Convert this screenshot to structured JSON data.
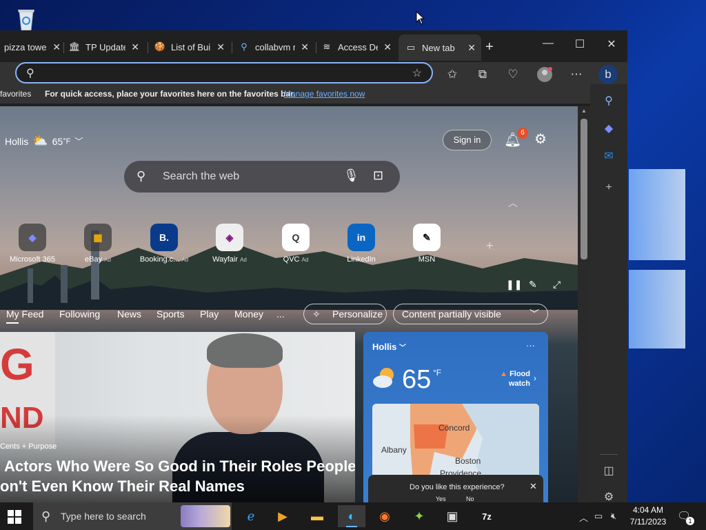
{
  "browser": {
    "tabs": [
      {
        "title": "pizza towe",
        "icon": "edge-page-icon"
      },
      {
        "title": "TP Update",
        "icon": "building-icon"
      },
      {
        "title": "List of Buil",
        "icon": "cookie-icon"
      },
      {
        "title": "collabvm r",
        "icon": "search-icon"
      },
      {
        "title": "Access De",
        "icon": "stack-icon"
      },
      {
        "title": "New tab",
        "icon": "newtab-icon"
      }
    ],
    "new_tab_symbol": "+",
    "address": {
      "value": "",
      "placeholder": ""
    },
    "favorites": {
      "left_label": "favorites",
      "message": "For quick access, place your favorites here on the favorites bar.",
      "link": "Manage favorites now"
    }
  },
  "newtab": {
    "location": "Hollis",
    "temp": "65",
    "unit": "°F",
    "signin": "Sign in",
    "notif_count": "6",
    "search_placeholder": "Search the web",
    "quick_links": [
      {
        "label": "Microsoft 365",
        "ad": "",
        "icon": "m365-icon",
        "glyph": "◆",
        "color": "#6d7ff2"
      },
      {
        "label": "eBay",
        "ad": "Ad",
        "icon": "ebay-icon",
        "glyph": "▦",
        "color": "#e53238"
      },
      {
        "label": "Booking.c...",
        "ad": "Ad",
        "icon": "booking-icon",
        "glyph": "B.",
        "color": "#0a3a8a"
      },
      {
        "label": "Wayfair",
        "ad": "Ad",
        "icon": "wayfair-icon",
        "glyph": "◈",
        "color": "#7f187f"
      },
      {
        "label": "QVC",
        "ad": "Ad",
        "icon": "qvc-icon",
        "glyph": "Q",
        "color": "#e23d3d"
      },
      {
        "label": "LinkedIn",
        "ad": "",
        "icon": "linkedin-icon",
        "glyph": "in",
        "color": "#0a66c2"
      },
      {
        "label": "MSN",
        "ad": "",
        "icon": "msn-icon",
        "glyph": "✎",
        "color": "#111111"
      }
    ],
    "feed_tabs": [
      "My Feed",
      "Following",
      "News",
      "Sports",
      "Play",
      "Money",
      "..."
    ],
    "personalize": "Personalize",
    "content_visibility": "Content partially visible",
    "hero": {
      "sign_text1": "G",
      "sign_text2": "ND",
      "source": "Cents + Purpose",
      "headline_line1": "Actors Who Were So Good in Their Roles People",
      "headline_line2": "on't Even Know Their Real Names"
    },
    "weather": {
      "city": "Hollis",
      "temp": "65",
      "unit": "°F",
      "alert": "Flood watch",
      "map_labels": [
        "Concord",
        "Albany",
        "Boston",
        "Providence"
      ]
    },
    "survey": {
      "question": "Do you like this experience?",
      "yes": "Yes",
      "no": "No"
    }
  },
  "taskbar": {
    "search_placeholder": "Type here to search",
    "time": "4:04 AM",
    "date": "7/11/2023",
    "notification_count": "1"
  }
}
